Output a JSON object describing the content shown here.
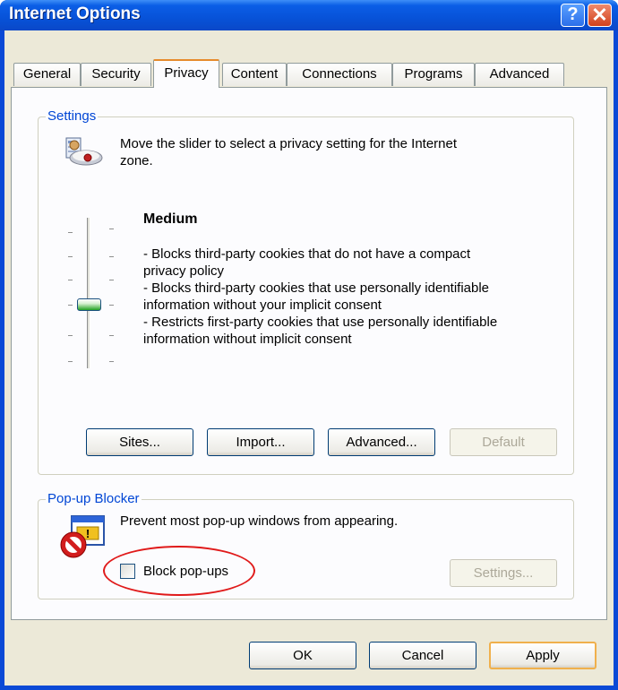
{
  "window": {
    "title": "Internet Options"
  },
  "title_buttons": {
    "help": "?",
    "close": "✕"
  },
  "tabs": [
    {
      "label": "General"
    },
    {
      "label": "Security"
    },
    {
      "label": "Privacy"
    },
    {
      "label": "Content"
    },
    {
      "label": "Connections"
    },
    {
      "label": "Programs"
    },
    {
      "label": "Advanced"
    }
  ],
  "active_tab": "Privacy",
  "settings": {
    "legend": "Settings",
    "instruction_line1": "Move the slider to select a privacy setting for the Internet",
    "instruction_line2": "zone.",
    "level_title": "Medium",
    "desc_lines": [
      "- Blocks third-party cookies that do not have a compact",
      "privacy policy",
      "- Blocks third-party cookies that use personally identifiable",
      "information without your implicit consent",
      "- Restricts first-party cookies that use personally identifiable",
      "information without implicit consent"
    ],
    "slider_level": 3,
    "slider_levels_total": 6,
    "buttons": {
      "sites": "Sites...",
      "import": "Import...",
      "advanced": "Advanced...",
      "default": "Default"
    }
  },
  "popup": {
    "legend": "Pop-up Blocker",
    "description": "Prevent most pop-up windows from appearing.",
    "checkbox_label": "Block pop-ups",
    "checked": false,
    "settings_button": "Settings..."
  },
  "footer": {
    "ok": "OK",
    "cancel": "Cancel",
    "apply": "Apply"
  },
  "colors": {
    "titlebar": "#0a58e0",
    "legend_text": "#0046d5",
    "highlight_oval": "#e01a1a"
  },
  "icons": {
    "privacy": "privacy-zone-icon",
    "popup": "popup-blocker-icon"
  }
}
